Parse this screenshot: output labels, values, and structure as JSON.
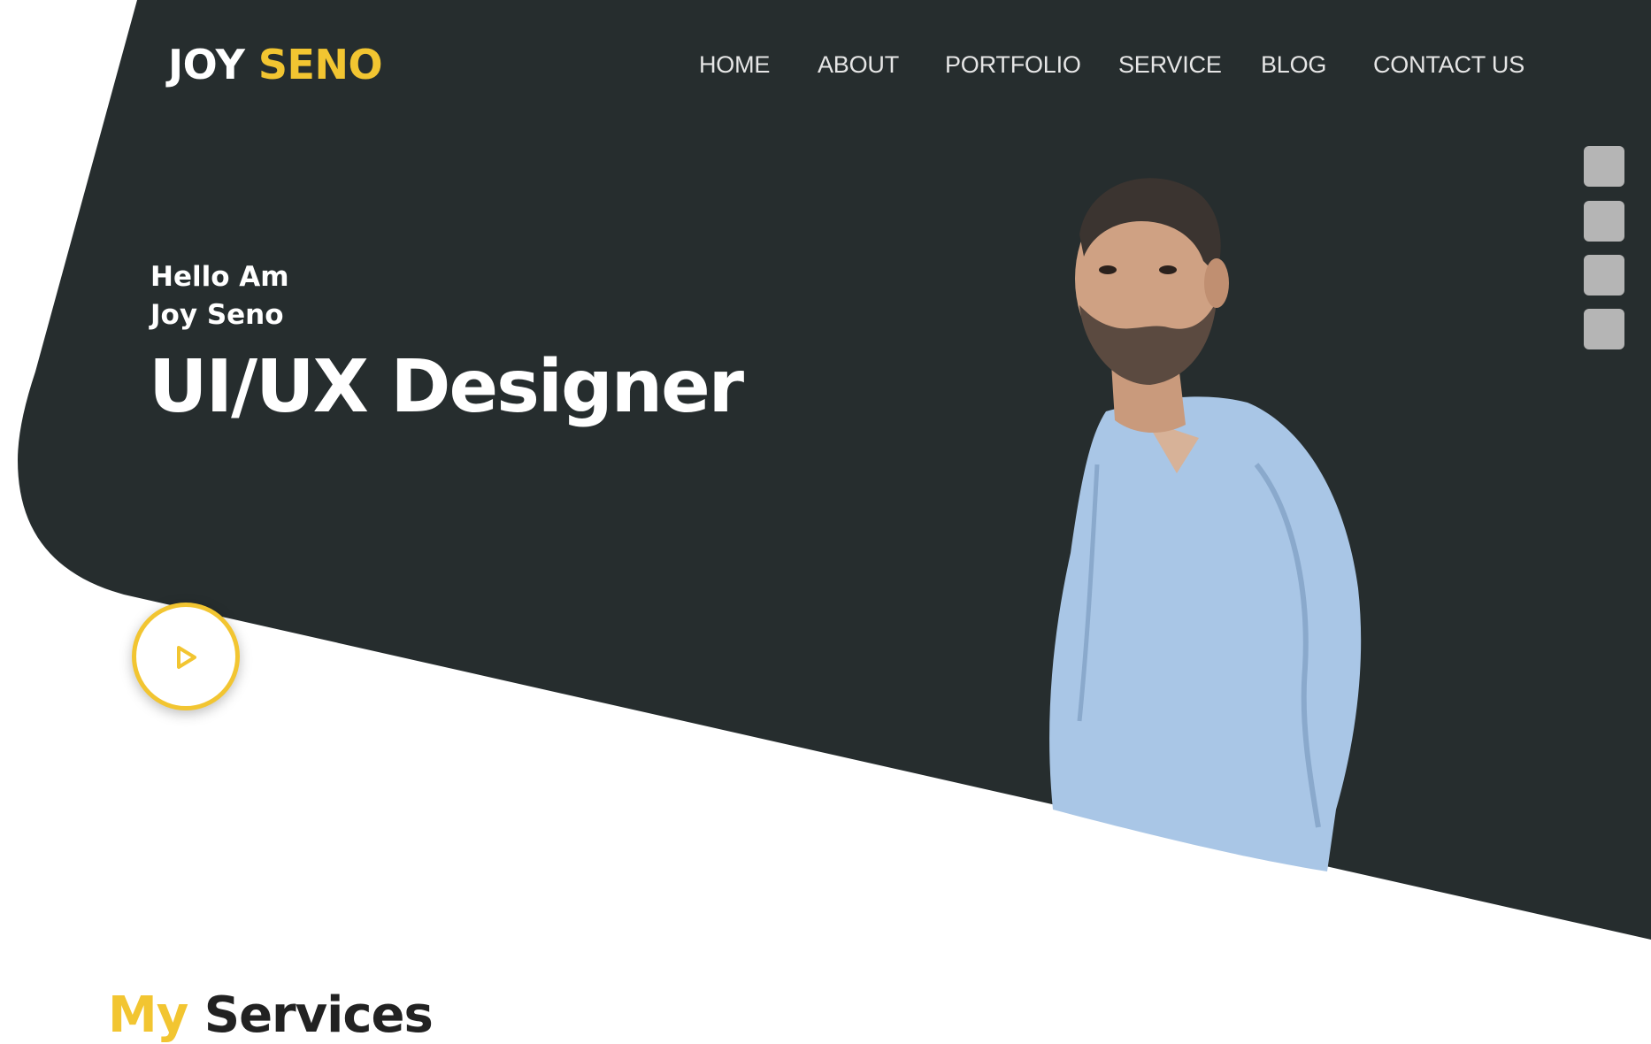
{
  "colors": {
    "hero_dark": "#262d2e",
    "accent": "#f2c531",
    "nav_text": "#e6e6e6",
    "side_dot": "#b5b5b5"
  },
  "brand": {
    "first": "JOY",
    "last": "SENO"
  },
  "nav": {
    "items": [
      {
        "label": "HOME"
      },
      {
        "label": "ABOUT"
      },
      {
        "label": "PORTFOLIO"
      },
      {
        "label": "SERVICE"
      },
      {
        "label": "BLOG"
      },
      {
        "label": "CONTACT US"
      }
    ]
  },
  "side_nav": {
    "dot_count": 4
  },
  "hero": {
    "greeting_line1": "Hello Am",
    "greeting_line2": "Joy Seno",
    "headline": "UI/UX Designer",
    "play_icon": "play-icon",
    "portrait_icon": "portrait-photo"
  },
  "services": {
    "title_accent": "My",
    "title_main": "Services"
  }
}
